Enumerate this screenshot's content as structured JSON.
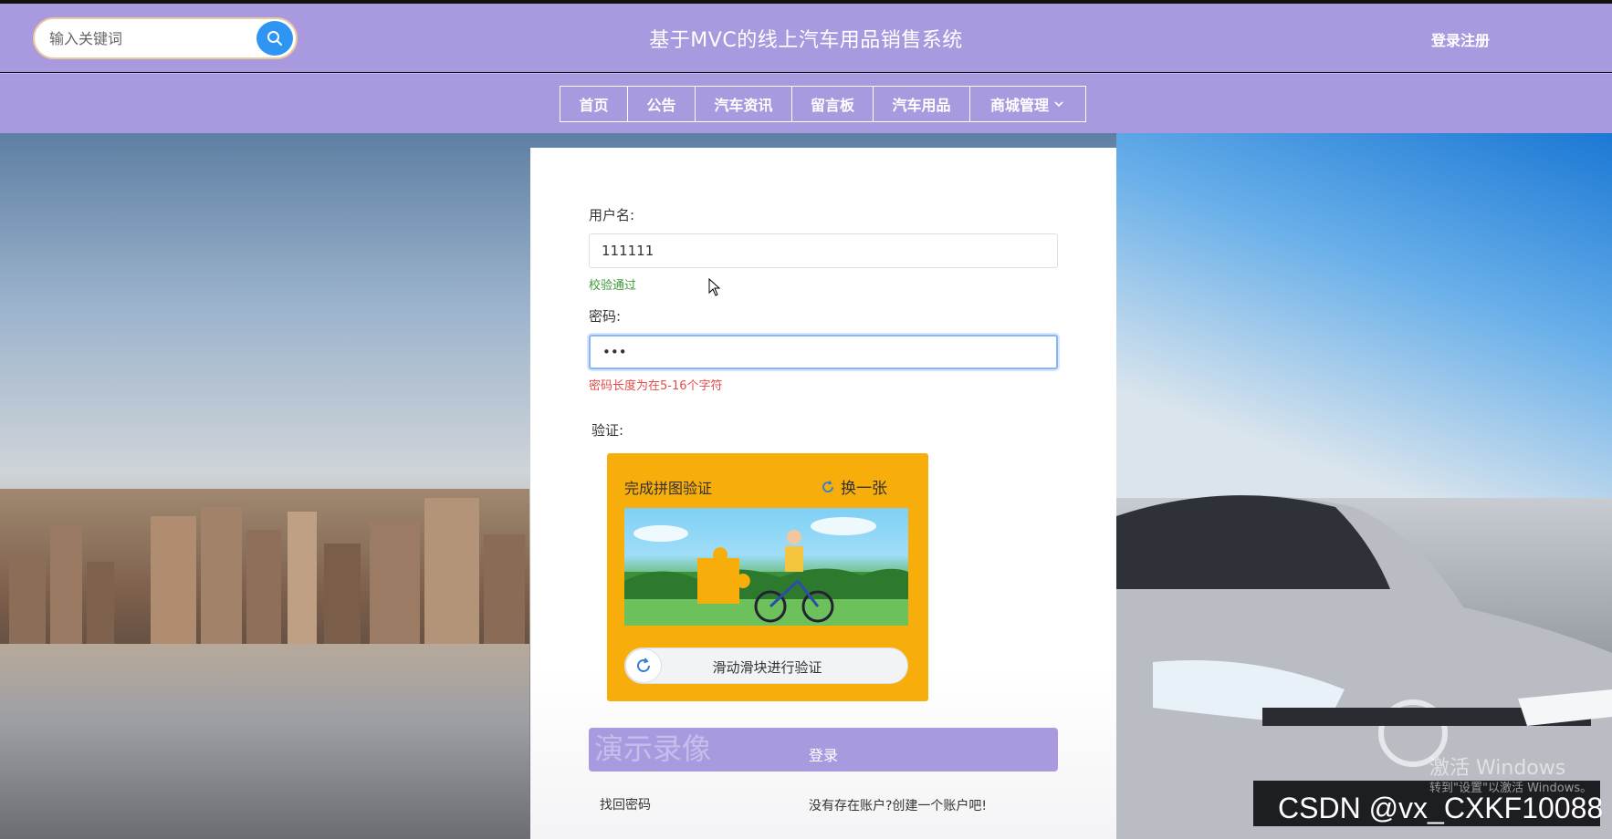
{
  "header": {
    "search": {
      "placeholder": "输入关键词"
    },
    "title": "基于MVC的线上汽车用品销售系统",
    "login_register": "登录注册"
  },
  "nav": {
    "items": [
      {
        "label": "首页"
      },
      {
        "label": "公告"
      },
      {
        "label": "汽车资讯"
      },
      {
        "label": "留言板"
      },
      {
        "label": "汽车用品"
      },
      {
        "label": "商城管理"
      }
    ]
  },
  "form": {
    "username_label": "用户名:",
    "username_value": "111111",
    "username_hint": "校验通过",
    "password_label": "密码:",
    "password_value": "•••",
    "password_hint": "密码长度为在5-16个字符",
    "captcha_label": "验证:",
    "captcha": {
      "title": "完成拼图验证",
      "refresh": "换一张",
      "slider_text": "滑动滑块进行验证"
    },
    "login_button": "登录",
    "forgot_password": "找回密码",
    "register_prompt": "没有存在账户?创建一个账户吧!"
  },
  "overlays": {
    "watermark_demo": "演示录像",
    "activate_windows": "激活 Windows",
    "activate_windows_sub": "转到\"设置\"以激活 Windows。",
    "csdn_watermark": "CSDN @vx_CXKF10088"
  },
  "colors": {
    "header_bg": "#a99ae0",
    "search_button": "#2f95f2",
    "captcha_bg": "#f7ad0a",
    "ok_hint": "#3a9a3a",
    "error_hint": "#e24b4b"
  }
}
